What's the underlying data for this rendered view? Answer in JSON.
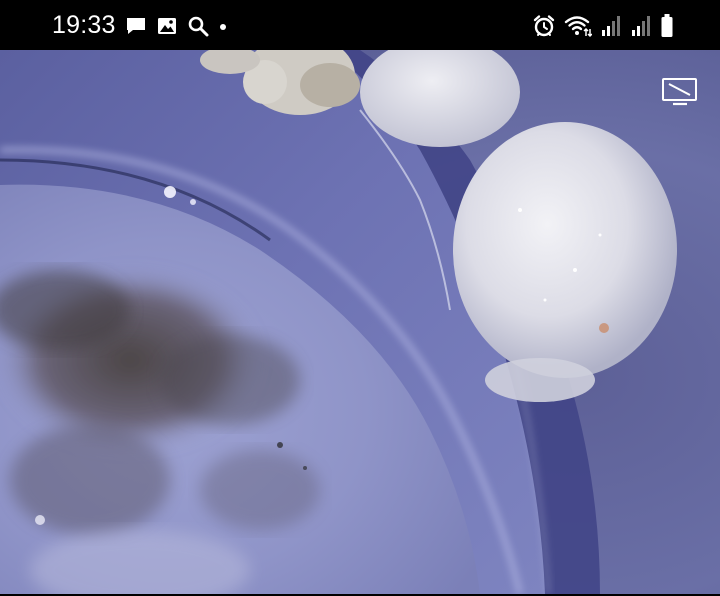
{
  "status_bar": {
    "time": "19:33",
    "left_icons": [
      "message-icon",
      "image-icon",
      "search-icon",
      "dot-icon"
    ],
    "right_icons": [
      "alarm-icon",
      "wifi-icon",
      "signal-icon",
      "signal-icon",
      "battery-icon"
    ]
  },
  "camera_view": {
    "cast_icon": "cast-icon"
  },
  "colors": {
    "status_bg": "#000000",
    "status_fg": "#ffffff",
    "scene_base": "#6e73a8"
  }
}
